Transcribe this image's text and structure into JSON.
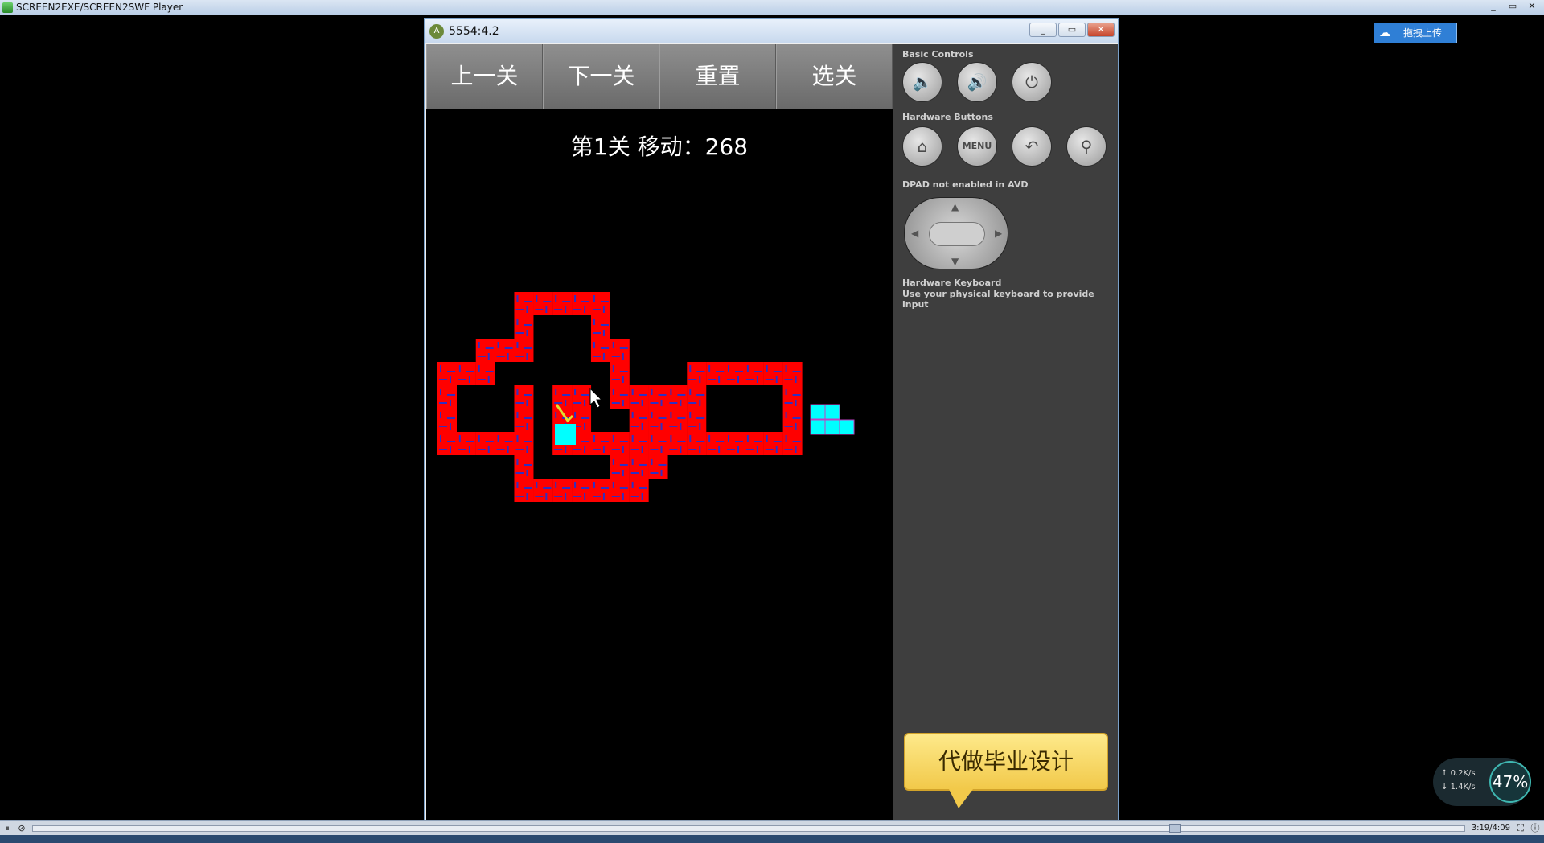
{
  "player_window": {
    "title": "SCREEN2EXE/SCREEN2SWF Player"
  },
  "outer_controls": [
    "_",
    "▭",
    "✕"
  ],
  "emulator": {
    "title": "5554:4.2",
    "window_controls": [
      "_",
      "▭",
      "✕"
    ],
    "game": {
      "buttons": [
        "上一关",
        "下一关",
        "重置",
        "选关"
      ],
      "status": "第1关 移动：268",
      "colors": {
        "wall": "#ff0000",
        "wall_line": "#3030c0",
        "target": "#00ffff",
        "floor": "#000000"
      }
    },
    "side_panel": {
      "basic_controls_label": "Basic Controls",
      "basic_controls": [
        {
          "icon": "volume-down-icon",
          "glyph": "🔈"
        },
        {
          "icon": "volume-up-icon",
          "glyph": "🔊"
        },
        {
          "icon": "power-icon",
          "glyph": "⏻"
        }
      ],
      "hardware_buttons_label": "Hardware Buttons",
      "hardware_buttons": [
        {
          "icon": "home-icon",
          "glyph": "⌂"
        },
        {
          "icon": "menu-icon",
          "glyph": "MENU"
        },
        {
          "icon": "back-icon",
          "glyph": "↶"
        },
        {
          "icon": "search-icon",
          "glyph": "⚲"
        }
      ],
      "dpad_label": "DPAD not enabled in AVD",
      "keyboard_label": "Hardware Keyboard",
      "keyboard_note": "Use your physical keyboard to provide input",
      "ad_text": "代做毕业设计"
    }
  },
  "upload_button": {
    "label": "拖拽上传",
    "icon": "cloud-icon"
  },
  "net_widget": {
    "up": "0.2K/s",
    "down": "1.4K/s",
    "percent": "47%"
  },
  "player_bar": {
    "time": "3:19/4:09",
    "progress": 0.8
  }
}
